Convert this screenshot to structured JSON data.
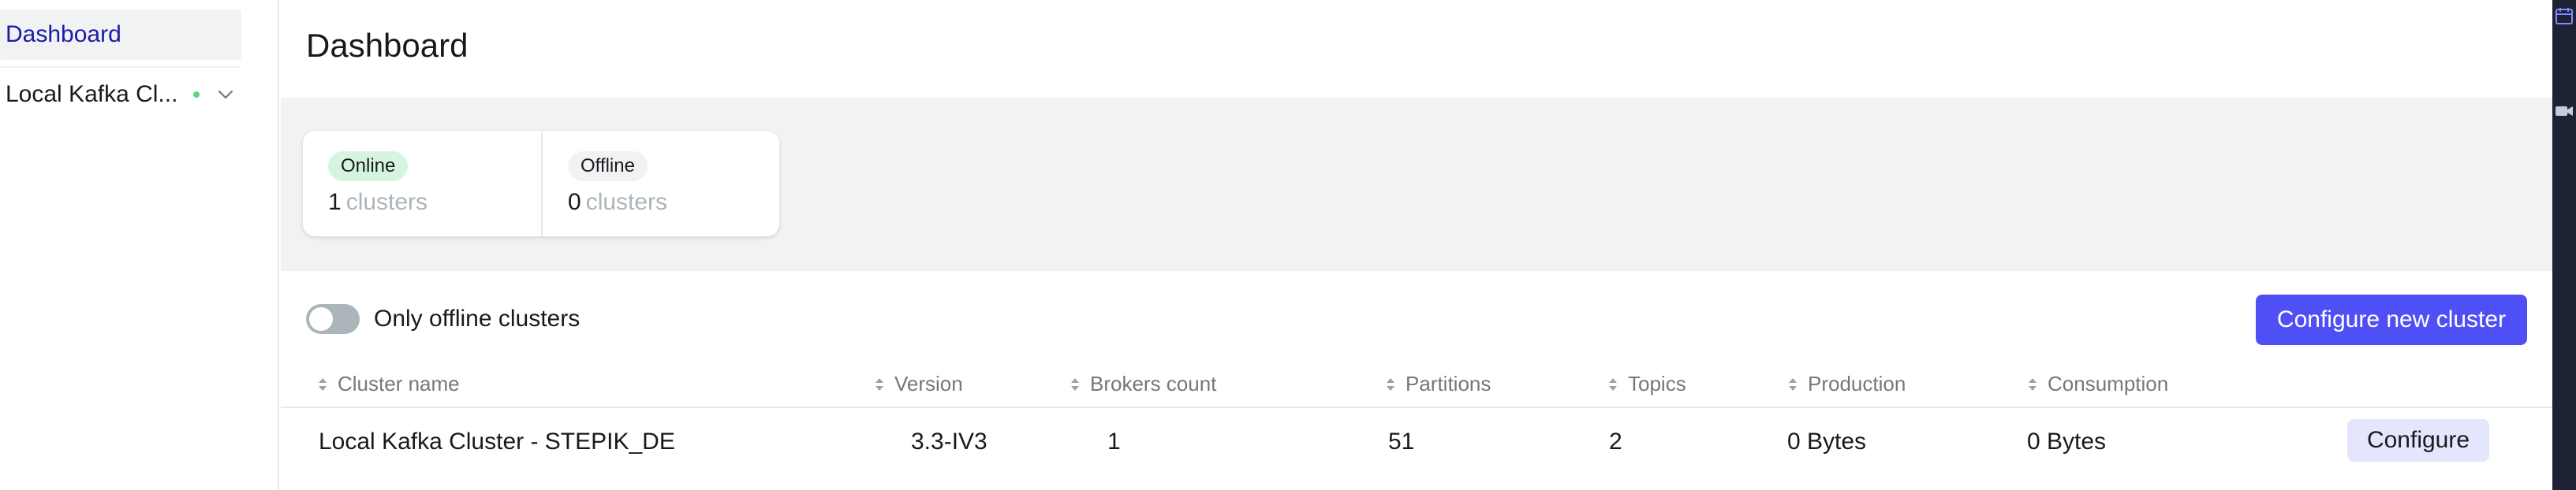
{
  "sidebar": {
    "items": [
      {
        "label": "Dashboard"
      },
      {
        "label": "Local Kafka Cl..."
      }
    ]
  },
  "main": {
    "title": "Dashboard",
    "metrics": [
      {
        "badge": "Online",
        "value": "1",
        "unit": "clusters"
      },
      {
        "badge": "Offline",
        "value": "0",
        "unit": "clusters"
      }
    ],
    "toggle_label": "Only offline clusters",
    "configure_new_label": "Configure new cluster",
    "table": {
      "headers": [
        "Cluster name",
        "Version",
        "Brokers count",
        "Partitions",
        "Topics",
        "Production",
        "Consumption"
      ],
      "rows": [
        {
          "cluster_name": "Local Kafka Cluster - STEPIK_DE",
          "version": "3.3-IV3",
          "brokers": "1",
          "partitions": "51",
          "topics": "2",
          "production": "0 Bytes",
          "consumption": "0 Bytes",
          "action": "Configure"
        }
      ]
    }
  },
  "icons": {
    "cluster_status": "status-dot-icon",
    "expand": "chevron-down-icon",
    "sort": "sort-icon"
  },
  "colors": {
    "accent": "#4f4ff6",
    "active_link": "#1c1ca4",
    "online_badge": "#d6f5e0",
    "online_dot": "#5cd685",
    "muted_text": "#abb5ba",
    "secondary_button": "#e3e6fc"
  }
}
